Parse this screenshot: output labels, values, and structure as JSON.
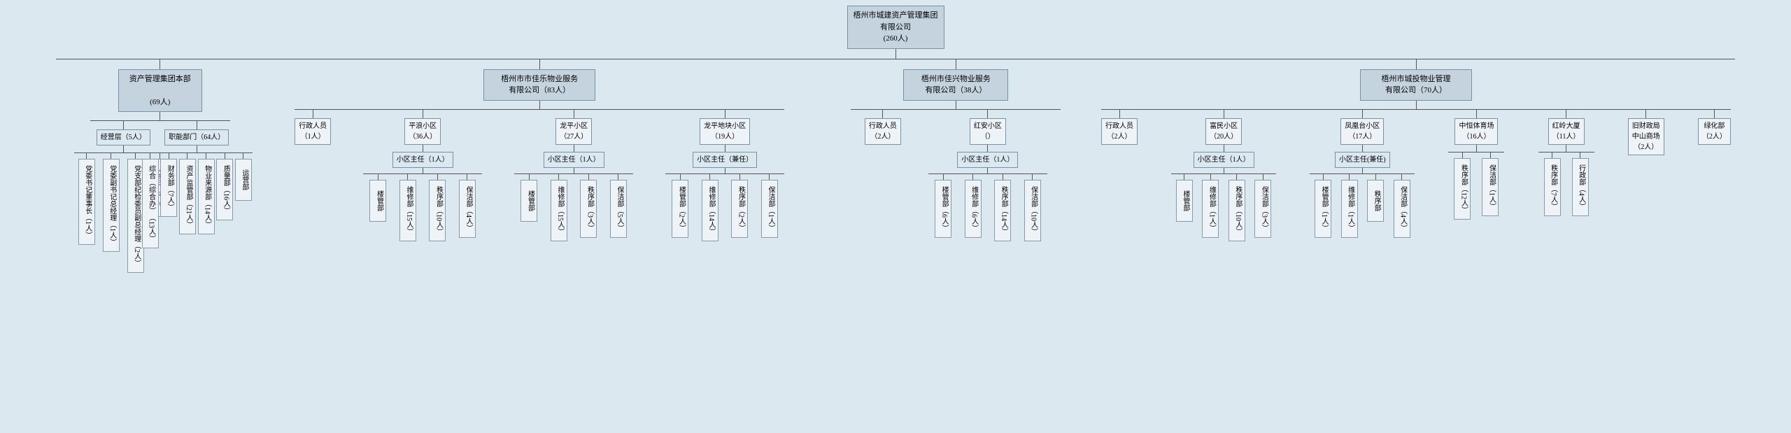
{
  "root": {
    "name": "梧州市城建资产管理集团\n有限公司",
    "count": "(260人)"
  },
  "branches": [
    {
      "id": "asset",
      "name": "资产管理集团本部",
      "count": "(69人)",
      "children": [
        {
          "id": "operations",
          "name": "经营层（5人）",
          "children": [
            {
              "name": "党委书记、董事长\n（1人）"
            },
            {
              "name": "党委副书记、总经理\n（1人）"
            },
            {
              "name": "党支部纪检委员、副总经理\n（2人）"
            },
            {
              "name": "总经理\n（1人）"
            }
          ]
        },
        {
          "id": "functional",
          "name": "职能部门（64人）",
          "children": [
            {
              "name": "综合\n（综合办）\n（13人）"
            },
            {
              "name": "财务部\n（7人）"
            },
            {
              "name": "资产监管部\n（21人）"
            },
            {
              "name": "物业来源部\n（14人）"
            },
            {
              "name": "质量部\n（16人）"
            },
            {
              "name": "运营部\n（）"
            }
          ]
        }
      ]
    },
    {
      "id": "jiale",
      "name": "梧州市市佳乐物业服务\n有限公司（83人）",
      "children": [
        {
          "id": "admin1",
          "name": "行政人员\n（1人）"
        },
        {
          "id": "pinglang",
          "name": "平浪小区\n（36人）",
          "children": [
            {
              "name": "小区主任（1人）",
              "children": [
                {
                  "name": "楼管部\n（）"
                },
                {
                  "name": "维修部\n（15人）"
                },
                {
                  "name": "秩序部\n（10人）"
                },
                {
                  "name": "保洁部\n（4人）"
                }
              ]
            }
          ]
        },
        {
          "id": "longping",
          "name": "龙平小区\n（27人）",
          "children": [
            {
              "name": "小区主任（1人）",
              "children": [
                {
                  "name": "楼管部\n（）"
                },
                {
                  "name": "维修部\n（15人）"
                },
                {
                  "name": "秩序部\n（3人）"
                },
                {
                  "name": "保洁部\n（5人）"
                }
              ]
            }
          ]
        },
        {
          "id": "longpingxiaoqu",
          "name": "龙平地块小区\n（19人）",
          "children": [
            {
              "name": "小区主任（兼任）",
              "children": [
                {
                  "name": "楼管部\n（2人）"
                },
                {
                  "name": "维修部\n（14人）"
                },
                {
                  "name": "秩序部\n（2人）"
                },
                {
                  "name": "保洁部\n（1人）"
                }
              ]
            }
          ]
        }
      ]
    },
    {
      "id": "jiaxing",
      "name": "梧州市佳兴物业服务\n有限公司（38人）",
      "children": [
        {
          "id": "admin2",
          "name": "行政人员\n（2人）"
        },
        {
          "id": "hongan",
          "name": "红安小区\n（）",
          "children": [
            {
              "name": "小区主任（1人）",
              "children": [
                {
                  "name": "楼管部\n（6人）"
                },
                {
                  "name": "维修部\n（6人）"
                },
                {
                  "name": "秩序部\n（14人）"
                },
                {
                  "name": "保洁部\n（10人）"
                }
              ]
            }
          ]
        }
      ]
    },
    {
      "id": "chengtou",
      "name": "梧州市城投物业管理\n有限公司（70人）",
      "children": [
        {
          "id": "admin3",
          "name": "行政人员\n（2人）"
        },
        {
          "id": "fuminxq",
          "name": "富民小区\n（20人）",
          "children": [
            {
              "name": "小区主任（1人）",
              "children": [
                {
                  "name": "楼管部\n（）"
                },
                {
                  "name": "维修部\n（1人）"
                },
                {
                  "name": "秩序部\n（10人）"
                },
                {
                  "name": "保洁部\n（3人）"
                }
              ]
            }
          ]
        },
        {
          "id": "fengtai",
          "name": "凤凰台小区\n（17人）",
          "children": [
            {
              "name": "小区主任(兼任)",
              "children": [
                {
                  "name": "楼管部\n（1人）"
                },
                {
                  "name": "维修部\n（1人）"
                },
                {
                  "name": "秩序部\n（）"
                },
                {
                  "name": "保洁部\n（4人）"
                }
              ]
            }
          ]
        },
        {
          "id": "zhongheng",
          "name": "中恒体育场\n（16人）",
          "children": [
            {
              "name": "秩序部\n（12人）"
            },
            {
              "name": "保洁部\n（1人）"
            }
          ]
        },
        {
          "id": "honglingda",
          "name": "红岭大厦\n（11人）",
          "children": [
            {
              "name": "秩序部\n（7人）"
            },
            {
              "name": "行政部\n（4人）"
            }
          ]
        },
        {
          "id": "jiucaiju",
          "name": "旧财政局\n中山商场\n（2人）"
        },
        {
          "id": "lühua",
          "name": "绿化部\n（2人）"
        }
      ]
    }
  ]
}
